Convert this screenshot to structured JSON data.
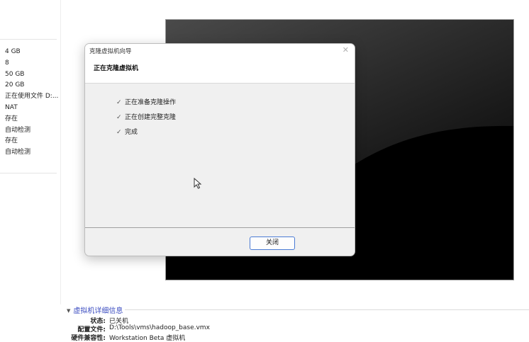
{
  "devices": {
    "values": [
      "4 GB",
      "8",
      "50 GB",
      "20 GB",
      "正在使用文件 D:...",
      "NAT",
      "存在",
      "自动检测",
      "存在",
      "自动检测"
    ]
  },
  "dialog": {
    "title": "克隆虚拟机向导",
    "close_glyph": "✕",
    "heading": "正在克隆虚拟机",
    "check_glyph": "✓",
    "steps": [
      "正在准备克隆操作",
      "正在创建完整克隆",
      "完成"
    ],
    "close_button": "关闭"
  },
  "details": {
    "header": "虚拟机详细信息",
    "state_label": "状态:",
    "state_value": "已关机",
    "config_label": "配置文件:",
    "config_value": "D:\\Tools\\vms\\hadoop_base.vmx",
    "compat_label": "硬件兼容性:",
    "compat_value": "Workstation Beta 虚拟机"
  },
  "icons": {
    "caret": "▼"
  }
}
